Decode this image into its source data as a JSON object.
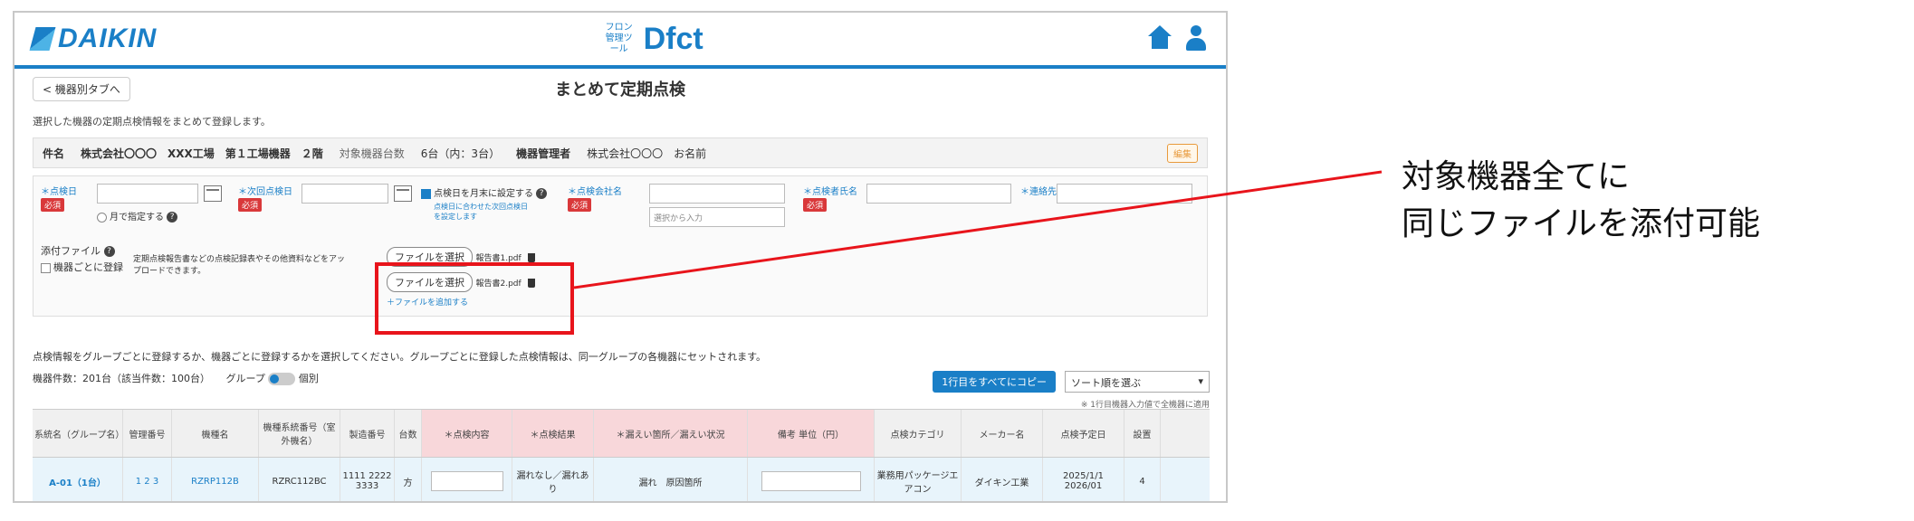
{
  "header": {
    "logo": "DAIKIN",
    "brand_small": "フロン管理ツール",
    "brand_main": "Dfct"
  },
  "subbar": {
    "back_label": "< 機器別タブへ",
    "title": "まとめて定期点検"
  },
  "description": "選択した機器の定期点検情報をまとめて登録します。",
  "summary": {
    "name_label": "件名",
    "name_value": "株式会社〇〇〇　XXX工場　第１工場機器　２階",
    "count_label": "対象機器台数",
    "count_value": "6台（内：3台）",
    "manager_label": "機器管理者",
    "manager_value": "株式会社〇〇〇　お名前",
    "button": "編集"
  },
  "form": {
    "date_label": "＊点検日",
    "date_required": "必須",
    "date_option": "月で指定する",
    "next_label": "＊次回点検日",
    "next_required": "必須",
    "same_check": "点検日を月末に設定する",
    "same_hint": "点検日に合わせた次回点検日を設定します",
    "company_label": "＊点検会社名",
    "company_required": "必須",
    "company_placeholder": "選択から入力",
    "inspector_label": "＊点検者氏名",
    "inspector_required": "必須",
    "mail_label": "＊連絡先",
    "attach_label": "添付ファイル",
    "attach_check": "機器ごとに登録",
    "attach_desc": "定期点検報告書などの点検記録表やその他資料などをアップロードできます。",
    "file_button_1": "ファイルを選択",
    "file_name_1": "報告書1.pdf",
    "file_button_2": "ファイルを選択",
    "file_name_2": "報告書2.pdf",
    "file_add": "＋ファイルを追加する"
  },
  "note": "点検情報をグループごとに登録するか、機器ごとに登録するかを選択してください。グループごとに登録した点検情報は、同一グループの各機器にセットされます。",
  "table_bar": {
    "count": "機器件数：201台（該当件数：100台）",
    "group": "グループ",
    "single": "個別",
    "copy_button": "1行目をすべてにコピー",
    "sort_select": "ソート順を選ぶ",
    "sort_note": "※ 1行目機器入力値で全機器に適用"
  },
  "table": {
    "headers": [
      "系統名（グループ名）",
      "管理番号",
      "機種名",
      "機種系統番号（室外機名）",
      "製造番号",
      "台数",
      "＊点検内容",
      "＊点検結果",
      "＊漏えい箇所／漏えい状況",
      "備考 単位（円）",
      "点検カテゴリ",
      "メーカー名",
      "点検予定日",
      "設置"
    ],
    "row": [
      "A-01（1台）",
      "1 2 3",
      "RZRP112B",
      "RZRC112BC",
      "1111 2222 3333",
      "方",
      "",
      "漏れなし／漏れあり",
      "漏れ　原因箇所",
      "",
      "業務用パッケージエアコン",
      "ダイキン工業",
      "2025/1/1 2026/01",
      "4"
    ]
  },
  "annotation": {
    "line1": "対象機器全てに",
    "line2": "同じファイルを添付可能",
    "color": "#e8141b"
  }
}
